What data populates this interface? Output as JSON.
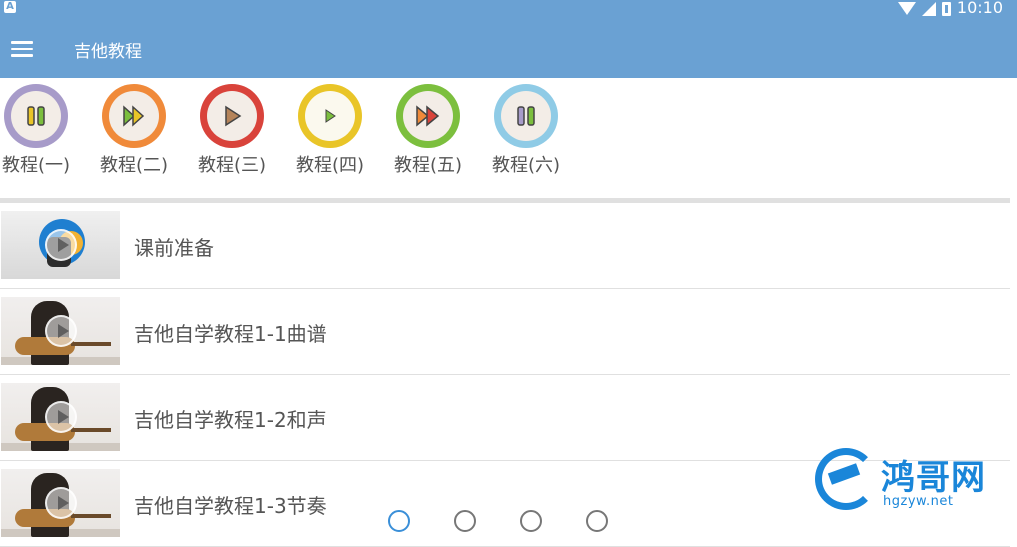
{
  "status_bar": {
    "notification_icon": "A",
    "time": "10:10",
    "icons": [
      "wifi-icon",
      "cell-signal-icon",
      "battery-icon"
    ]
  },
  "app_bar": {
    "menu_icon": "hamburger-menu-icon",
    "title": "吉他教程",
    "background_color": "#6aa1d3"
  },
  "tutorials": [
    {
      "label": "教程(一)",
      "ring_color": "#a79bc9",
      "icon": "pause-icon"
    },
    {
      "label": "教程(二)",
      "ring_color": "#f08a3a",
      "icon": "fast-forward-icon"
    },
    {
      "label": "教程(三)",
      "ring_color": "#d9433b",
      "icon": "play-icon"
    },
    {
      "label": "教程(四)",
      "ring_color": "#e9c528",
      "icon": "play-icon"
    },
    {
      "label": "教程(五)",
      "ring_color": "#7cbf3e",
      "icon": "fast-forward-icon"
    },
    {
      "label": "教程(六)",
      "ring_color": "#8fcbe6",
      "icon": "pause-icon"
    }
  ],
  "lessons": [
    {
      "title": "课前准备",
      "thumbnail": "intro-logo"
    },
    {
      "title": "吉他自学教程1-1曲谱",
      "thumbnail": "guitarist"
    },
    {
      "title": "吉他自学教程1-2和声",
      "thumbnail": "guitarist"
    },
    {
      "title": "吉他自学教程1-3节奏",
      "thumbnail": "guitarist"
    }
  ],
  "watermark": {
    "text": "鸿哥网",
    "url": "hgzyw.net",
    "color": "#1a86d9"
  }
}
